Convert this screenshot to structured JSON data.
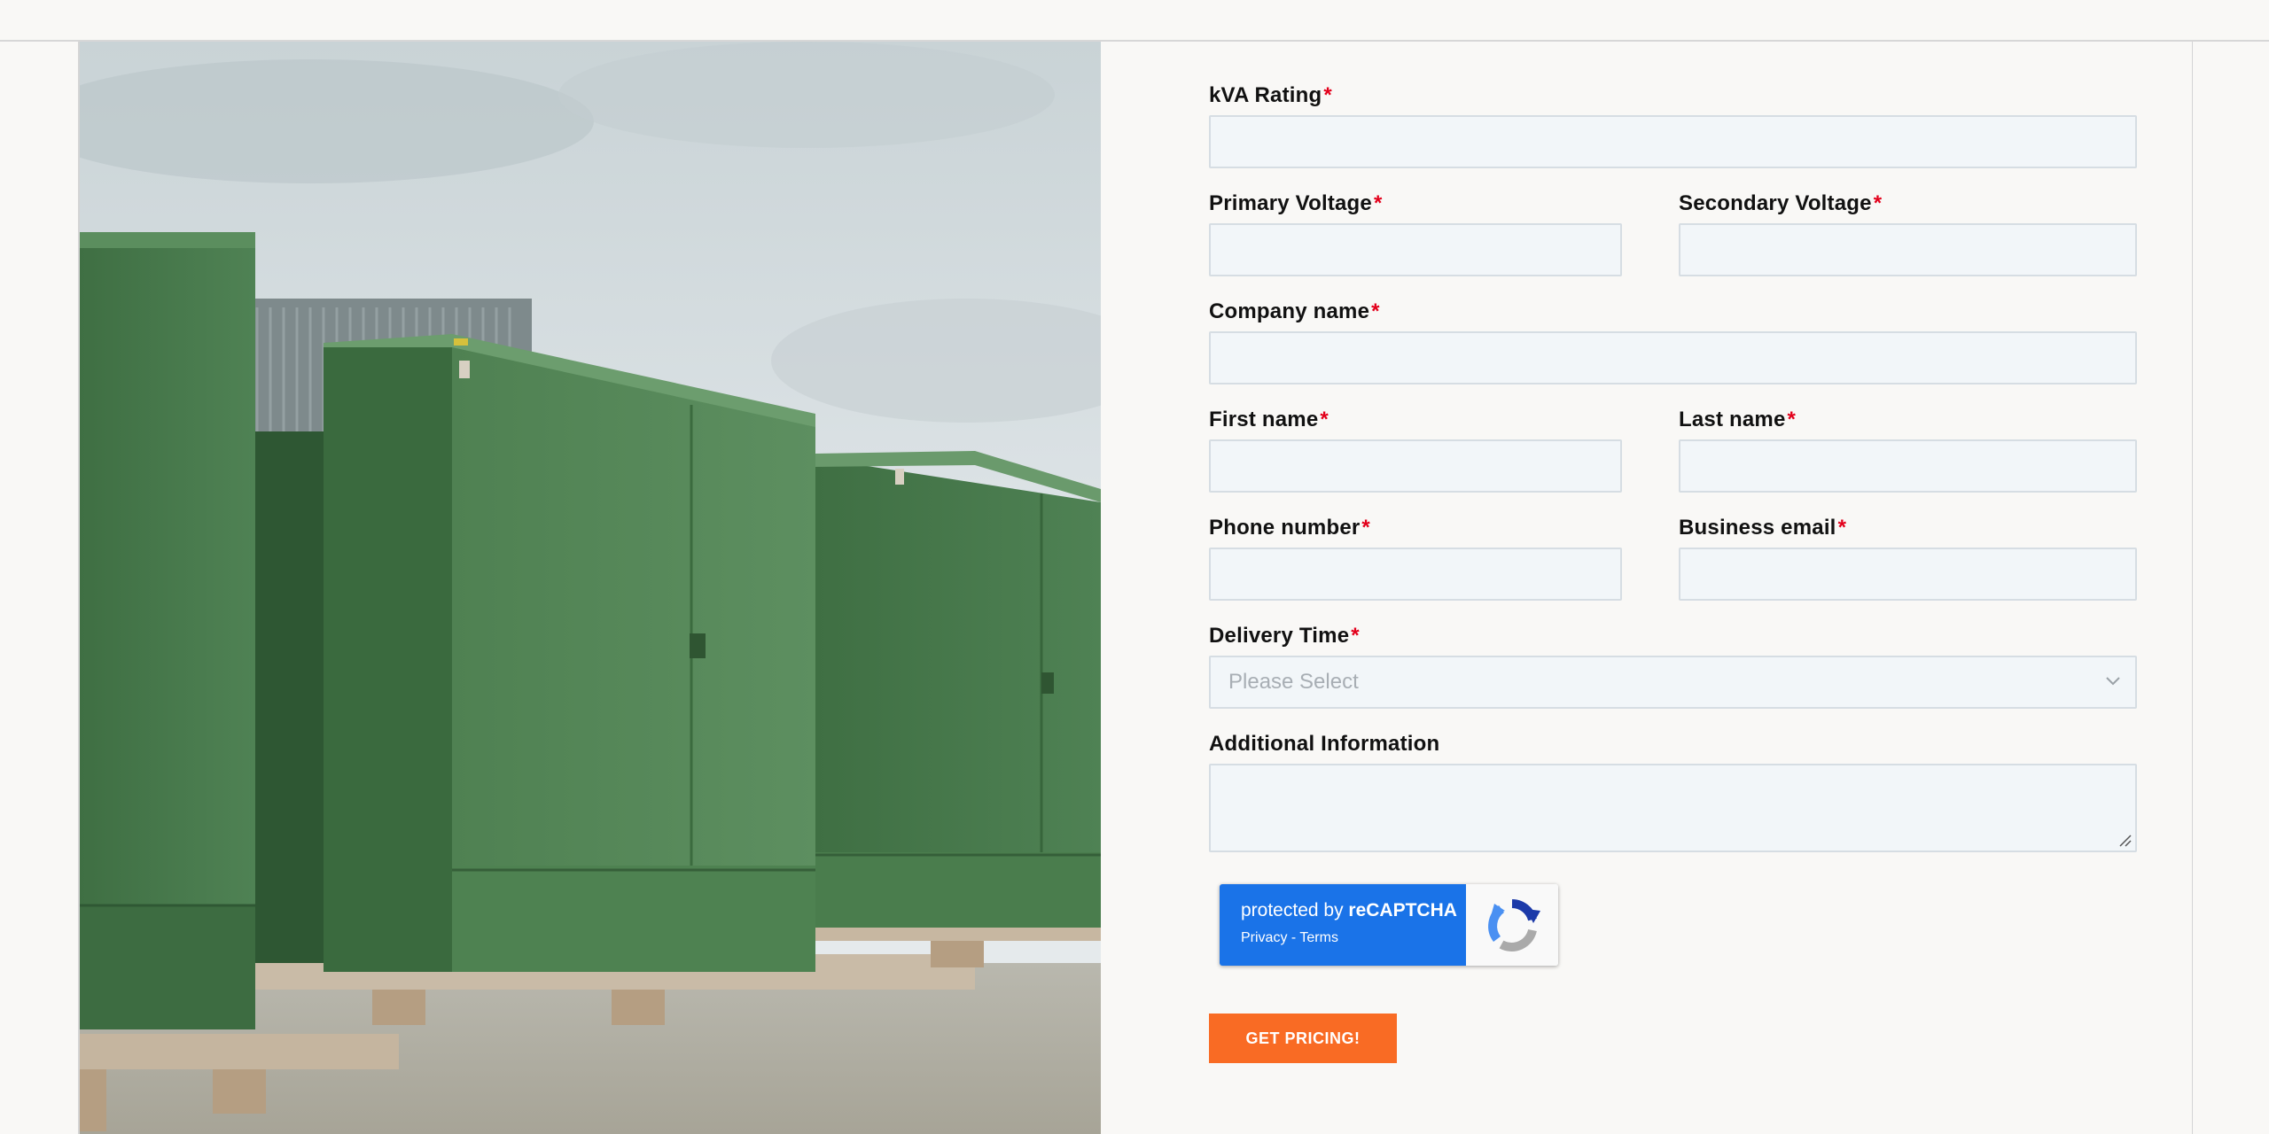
{
  "form": {
    "required_marker": "*",
    "kva_label": "kVA Rating",
    "primary_voltage_label": "Primary Voltage",
    "secondary_voltage_label": "Secondary Voltage",
    "company_label": "Company name",
    "first_name_label": "First name",
    "last_name_label": "Last name",
    "phone_label": "Phone number",
    "email_label": "Business email",
    "delivery_label": "Delivery Time",
    "delivery_placeholder": "Please Select",
    "additional_label": "Additional Information",
    "submit_label": "GET PRICING!"
  },
  "recaptcha": {
    "protected_by": "protected by ",
    "brand": "reCAPTCHA",
    "privacy": "Privacy",
    "separator": " - ",
    "terms": "Terms"
  },
  "colors": {
    "accent": "#f96b24",
    "required": "#e3001b",
    "recaptcha_blue": "#1a73e8",
    "field_bg": "#f2f6f9"
  }
}
